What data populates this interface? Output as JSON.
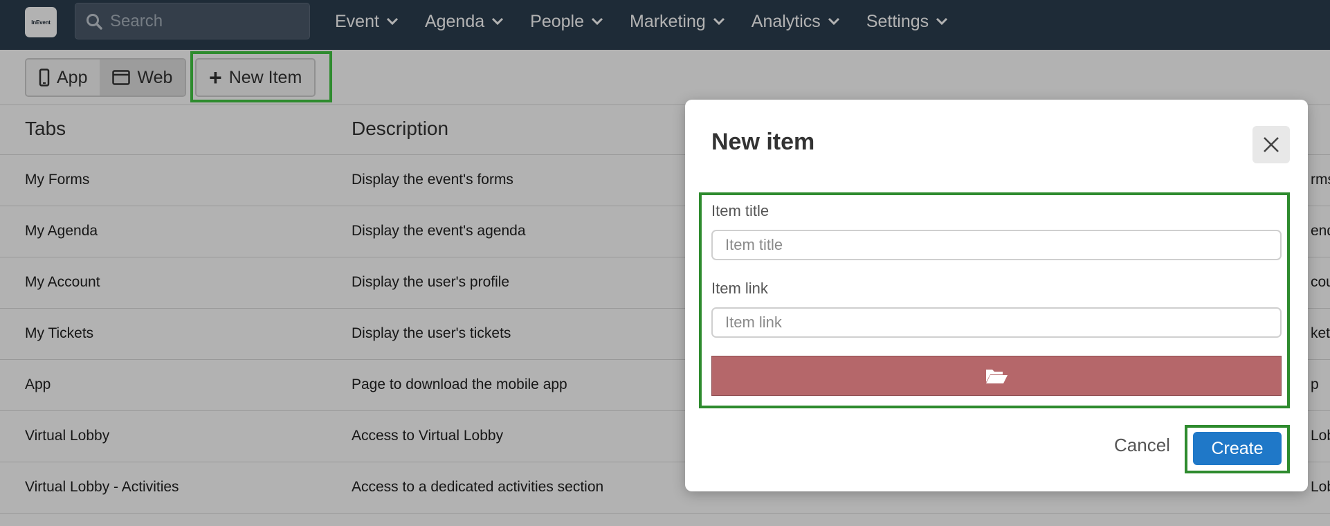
{
  "nav": {
    "logo_text": "InEvent",
    "search_placeholder": "Search",
    "menu": [
      {
        "label": "Event"
      },
      {
        "label": "Agenda"
      },
      {
        "label": "People"
      },
      {
        "label": "Marketing"
      },
      {
        "label": "Analytics"
      },
      {
        "label": "Settings"
      }
    ]
  },
  "toolbar": {
    "app_label": "App",
    "web_label": "Web",
    "new_item_label": "New Item"
  },
  "table": {
    "headers": [
      "Tabs",
      "Description"
    ],
    "rows": [
      {
        "tab": "My Forms",
        "description": "Display the event's forms",
        "clipped": "rms"
      },
      {
        "tab": "My Agenda",
        "description": "Display the event's agenda",
        "clipped": "end"
      },
      {
        "tab": "My Account",
        "description": "Display the user's profile",
        "clipped": "cou"
      },
      {
        "tab": "My Tickets",
        "description": "Display the user's tickets",
        "clipped": "kets"
      },
      {
        "tab": "App",
        "description": "Page to download the mobile app",
        "clipped": "p"
      },
      {
        "tab": "Virtual Lobby",
        "description": "Access to Virtual Lobby",
        "clipped": "Lob"
      },
      {
        "tab": "Virtual Lobby - Activities",
        "description": "Access to a dedicated activities section",
        "clipped": "Lob"
      }
    ]
  },
  "modal": {
    "title": "New item",
    "item_title_label": "Item title",
    "item_title_placeholder": "Item title",
    "item_link_label": "Item link",
    "item_link_placeholder": "Item link",
    "cancel_label": "Cancel",
    "create_label": "Create"
  },
  "colors": {
    "nav_bg": "#2c3e50",
    "highlight": "#2e8b2e",
    "upload_button": "#b5676a",
    "create_button": "#1f78c8"
  }
}
